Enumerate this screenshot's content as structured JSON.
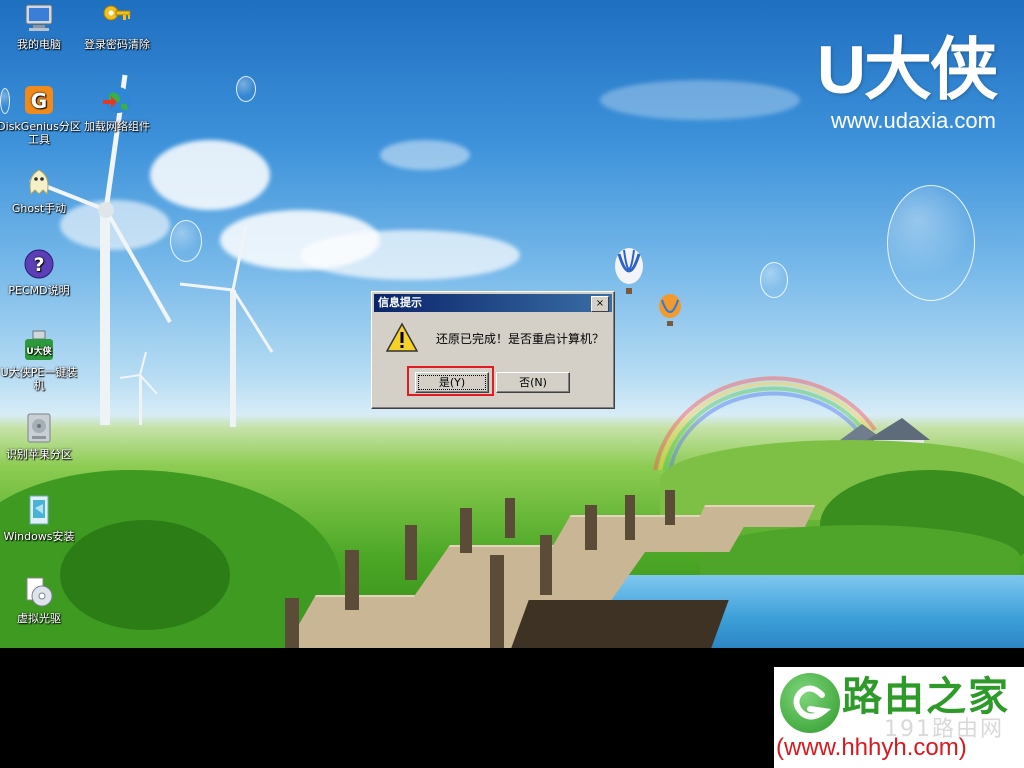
{
  "desktop_icons": [
    {
      "label": "我的电脑",
      "icon": "computer-icon"
    },
    {
      "label": "登录密码清除",
      "icon": "key-icon"
    },
    {
      "label": "DiskGenius分区工具",
      "icon": "diskgenius-icon"
    },
    {
      "label": "加载网络组件",
      "icon": "network-globe-icon"
    },
    {
      "label": "Ghost手动",
      "icon": "ghost-icon"
    },
    {
      "label": "PECMD说明",
      "icon": "help-icon"
    },
    {
      "label": "U大侠PE一键装机",
      "icon": "udaxia-installer-icon"
    },
    {
      "label": "识别苹果分区",
      "icon": "disk-icon"
    },
    {
      "label": "Windows安装",
      "icon": "windows-install-icon"
    },
    {
      "label": "虚拟光驱",
      "icon": "virtual-cd-icon"
    }
  ],
  "brand": {
    "name": "U大侠",
    "url": "www.udaxia.com"
  },
  "dialog": {
    "title": "信息提示",
    "close_label": "×",
    "message": "还原已完成！是否重启计算机？",
    "icon": "warning-icon",
    "yes_label": "是(Y)",
    "no_label": "否(N)"
  },
  "highlight_color": "#e21b23",
  "watermark": {
    "title": "路由之家",
    "subtitle": "191路由网",
    "url": "(www.hhhyh.com)",
    "logo": "router-home-logo"
  }
}
